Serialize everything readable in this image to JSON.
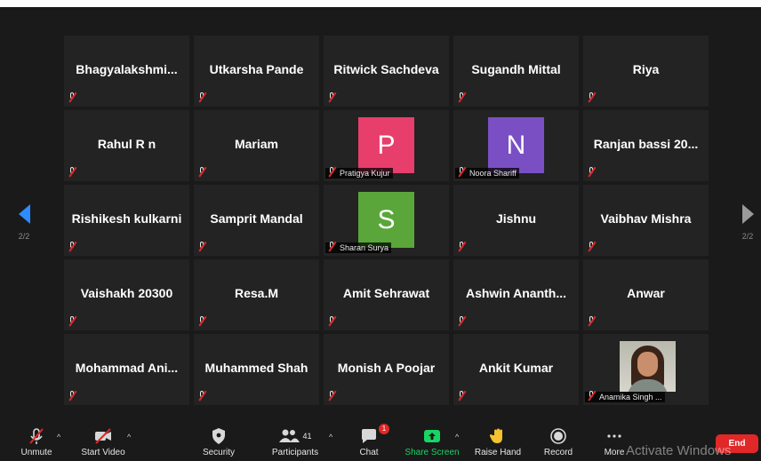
{
  "pager": {
    "left": "2/2",
    "right": "2/2"
  },
  "participants": [
    {
      "name": "Bhagyalakshmi..."
    },
    {
      "name": "Utkarsha Pande"
    },
    {
      "name": "Ritwick Sachdeva"
    },
    {
      "name": "Sugandh Mittal"
    },
    {
      "name": "Riya"
    },
    {
      "name": "Rahul R n"
    },
    {
      "name": "Mariam"
    },
    {
      "label": "Pratigya Kujur",
      "initial": "P",
      "color": "#e83e6c"
    },
    {
      "label": "Noora Shariff",
      "initial": "N",
      "color": "#7b4fc4"
    },
    {
      "name": "Ranjan bassi 20..."
    },
    {
      "name": "Rishikesh kulkarni"
    },
    {
      "name": "Samprit Mandal"
    },
    {
      "label": "Sharan Surya",
      "initial": "S",
      "color": "#5aa63a"
    },
    {
      "name": "Jishnu"
    },
    {
      "name": "Vaibhav Mishra"
    },
    {
      "name": "Vaishakh 20300"
    },
    {
      "name": "Resa.M"
    },
    {
      "name": "Amit Sehrawat"
    },
    {
      "name": "Ashwin Ananth..."
    },
    {
      "name": "Anwar"
    },
    {
      "name": "Mohammad Ani..."
    },
    {
      "name": "Muhammed Shah"
    },
    {
      "name": "Monish A Poojar"
    },
    {
      "name": "Ankit Kumar"
    },
    {
      "label": "Anamika Singh ..."
    }
  ],
  "toolbar": {
    "unmute": "Unmute",
    "start_video": "Start Video",
    "security": "Security",
    "participants": "Participants",
    "participants_count": "41",
    "chat": "Chat",
    "chat_badge": "1",
    "share_screen": "Share Screen",
    "raise_hand": "Raise Hand",
    "record": "Record",
    "more": "More",
    "end": "End"
  },
  "watermark": "Activate Windows",
  "colors": {
    "accent": "#2d8cff",
    "share": "#19d464",
    "end": "#e02828"
  }
}
